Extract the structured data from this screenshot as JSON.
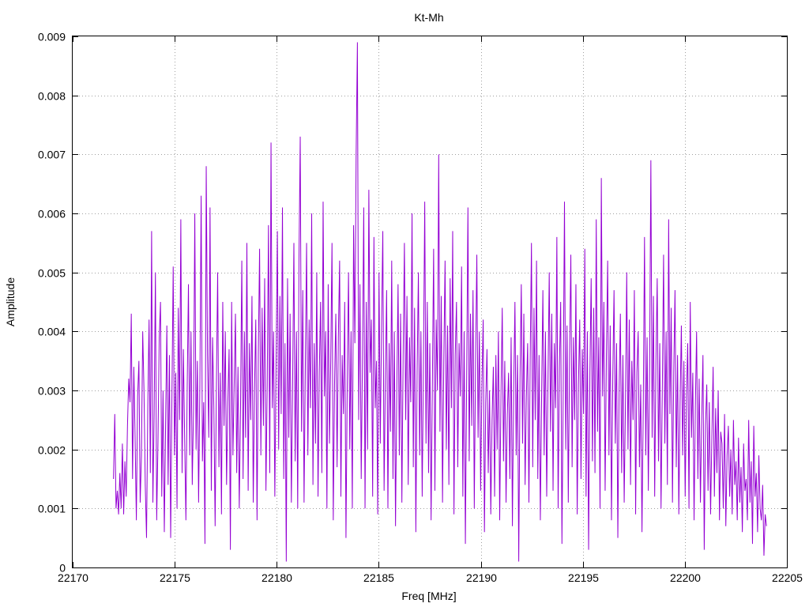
{
  "chart_data": {
    "type": "line",
    "title": "Kt-Mh",
    "xlabel": "Freq [MHz]",
    "ylabel": "Amplitude",
    "xlim": [
      22170,
      22205
    ],
    "ylim": [
      0,
      0.009
    ],
    "x_ticks": [
      "22170",
      "22175",
      "22180",
      "22185",
      "22190",
      "22195",
      "22200",
      "22205"
    ],
    "y_ticks": [
      "0",
      "0.001",
      "0.002",
      "0.003",
      "0.004",
      "0.005",
      "0.006",
      "0.007",
      "0.008",
      "0.009"
    ],
    "grid": true,
    "legend": "none",
    "series": [
      {
        "color": "#9400d3",
        "x_start": 22172.0,
        "x_end": 22204.0,
        "values": [
          0.0015,
          0.0026,
          0.001,
          0.0013,
          0.0009,
          0.0016,
          0.001,
          0.0021,
          0.0009,
          0.0018,
          0.0012,
          0.0024,
          0.0032,
          0.0028,
          0.0043,
          0.0015,
          0.0034,
          0.0022,
          0.0008,
          0.0029,
          0.0035,
          0.0011,
          0.0019,
          0.004,
          0.003,
          0.0014,
          0.0005,
          0.0027,
          0.0042,
          0.0016,
          0.0057,
          0.0011,
          0.0026,
          0.005,
          0.0008,
          0.0021,
          0.0039,
          0.0045,
          0.0012,
          0.003,
          0.0006,
          0.0024,
          0.0041,
          0.0014,
          0.0036,
          0.0005,
          0.0029,
          0.0051,
          0.0019,
          0.0033,
          0.001,
          0.0044,
          0.0025,
          0.0059,
          0.0016,
          0.0037,
          0.0022,
          0.0008,
          0.003,
          0.0048,
          0.0019,
          0.004,
          0.0014,
          0.0027,
          0.006,
          0.002,
          0.0035,
          0.0011,
          0.0031,
          0.0063,
          0.0018,
          0.0028,
          0.0004,
          0.0068,
          0.0036,
          0.0022,
          0.0061,
          0.0013,
          0.0039,
          0.0027,
          0.0007,
          0.0031,
          0.005,
          0.0017,
          0.0033,
          0.0009,
          0.0045,
          0.0024,
          0.004,
          0.0014,
          0.0028,
          0.0037,
          0.0003,
          0.0045,
          0.0019,
          0.0031,
          0.0043,
          0.0016,
          0.0034,
          0.001,
          0.0027,
          0.0052,
          0.0015,
          0.004,
          0.0022,
          0.0055,
          0.0013,
          0.0038,
          0.0025,
          0.0046,
          0.0011,
          0.003,
          0.0042,
          0.0008,
          0.0036,
          0.0054,
          0.0019,
          0.0044,
          0.0024,
          0.0049,
          0.0013,
          0.0031,
          0.0058,
          0.0016,
          0.0072,
          0.0027,
          0.004,
          0.0012,
          0.0035,
          0.0057,
          0.002,
          0.0046,
          0.0026,
          0.0061,
          0.0015,
          0.0038,
          0.0001,
          0.0049,
          0.0022,
          0.0043,
          0.0011,
          0.0031,
          0.0055,
          0.0018,
          0.004,
          0.001,
          0.0052,
          0.0073,
          0.0023,
          0.0047,
          0.0011,
          0.0034,
          0.0055,
          0.0019,
          0.0042,
          0.0027,
          0.006,
          0.0014,
          0.0038,
          0.0021,
          0.005,
          0.0012,
          0.0033,
          0.0045,
          0.0016,
          0.0062,
          0.0029,
          0.004,
          0.001,
          0.0048,
          0.0021,
          0.0035,
          0.0055,
          0.0008,
          0.0031,
          0.0043,
          0.0017,
          0.0039,
          0.0052,
          0.0012,
          0.0036,
          0.0026,
          0.0045,
          0.0005,
          0.0031,
          0.005,
          0.002,
          0.004,
          0.001,
          0.0058,
          0.0038,
          0.007,
          0.0089,
          0.0025,
          0.0048,
          0.0015,
          0.0036,
          0.0061,
          0.001,
          0.0045,
          0.002,
          0.0064,
          0.0033,
          0.0042,
          0.0012,
          0.0056,
          0.0027,
          0.0035,
          0.0009,
          0.005,
          0.0021,
          0.0041,
          0.0057,
          0.0013,
          0.0032,
          0.0047,
          0.001,
          0.0038,
          0.0023,
          0.0052,
          0.0015,
          0.004,
          0.0007,
          0.003,
          0.0048,
          0.0019,
          0.0043,
          0.0011,
          0.0036,
          0.0055,
          0.0025,
          0.0046,
          0.0014,
          0.0039,
          0.0028,
          0.006,
          0.0017,
          0.0044,
          0.0006,
          0.0033,
          0.005,
          0.0019,
          0.004,
          0.0012,
          0.0035,
          0.0062,
          0.0021,
          0.0045,
          0.0016,
          0.0038,
          0.0008,
          0.0031,
          0.0054,
          0.0013,
          0.0042,
          0.003,
          0.007,
          0.0023,
          0.0046,
          0.0011,
          0.0035,
          0.0052,
          0.002,
          0.0041,
          0.0014,
          0.0049,
          0.0027,
          0.0057,
          0.0009,
          0.0036,
          0.0045,
          0.0017,
          0.0038,
          0.0029,
          0.0051,
          0.0012,
          0.004,
          0.0004,
          0.0032,
          0.0061,
          0.0018,
          0.0043,
          0.0024,
          0.0047,
          0.001,
          0.0035,
          0.0053,
          0.0022,
          0.004,
          0.0013,
          0.0031,
          0.0042,
          0.0006,
          0.0028,
          0.0037,
          0.0016,
          0.003,
          0.0009,
          0.0025,
          0.0034,
          0.0012,
          0.0036,
          0.002,
          0.004,
          0.0008,
          0.0029,
          0.0044,
          0.0018,
          0.0035,
          0.0011,
          0.0026,
          0.0033,
          0.0015,
          0.0039,
          0.0007,
          0.003,
          0.0045,
          0.0019,
          0.0036,
          0.0001,
          0.0032,
          0.0048,
          0.0021,
          0.0043,
          0.0014,
          0.0029,
          0.0038,
          0.0011,
          0.0035,
          0.0055,
          0.0017,
          0.0044,
          0.0025,
          0.0052,
          0.0015,
          0.0036,
          0.0008,
          0.0029,
          0.0047,
          0.0019,
          0.004,
          0.0012,
          0.0031,
          0.005,
          0.0023,
          0.0043,
          0.0013,
          0.0038,
          0.0027,
          0.0056,
          0.001,
          0.0034,
          0.0045,
          0.0004,
          0.003,
          0.0062,
          0.002,
          0.0041,
          0.0011,
          0.0036,
          0.0053,
          0.0017,
          0.0039,
          0.0025,
          0.0048,
          0.0009,
          0.0031,
          0.0042,
          0.0015,
          0.0037,
          0.0026,
          0.0054,
          0.0012,
          0.004,
          0.0003,
          0.0033,
          0.0049,
          0.0018,
          0.0044,
          0.0016,
          0.0059,
          0.0023,
          0.0039,
          0.001,
          0.0066,
          0.0029,
          0.0045,
          0.0013,
          0.0036,
          0.0052,
          0.0019,
          0.0041,
          0.0008,
          0.0032,
          0.0047,
          0.0021,
          0.0038,
          0.0005,
          0.003,
          0.0043,
          0.0016,
          0.0036,
          0.0011,
          0.0028,
          0.005,
          0.002,
          0.0042,
          0.0014,
          0.0035,
          0.0025,
          0.0047,
          0.0009,
          0.0033,
          0.004,
          0.0017,
          0.0031,
          0.0006,
          0.0027,
          0.0056,
          0.0019,
          0.0039,
          0.0013,
          0.0034,
          0.0069,
          0.0022,
          0.0046,
          0.0012,
          0.0035,
          0.0049,
          0.0018,
          0.0038,
          0.001,
          0.003,
          0.0053,
          0.0021,
          0.004,
          0.0014,
          0.0059,
          0.0026,
          0.0044,
          0.0011,
          0.0033,
          0.0047,
          0.0017,
          0.0036,
          0.0009,
          0.0028,
          0.0041,
          0.0019,
          0.0035,
          0.0012,
          0.0029,
          0.0038,
          0.001,
          0.0045,
          0.0022,
          0.0033,
          0.0008,
          0.0027,
          0.004,
          0.0015,
          0.0032,
          0.0011,
          0.0025,
          0.0036,
          0.0003,
          0.0024,
          0.0031,
          0.0013,
          0.0028,
          0.0009,
          0.0022,
          0.0034,
          0.0012,
          0.0027,
          0.0016,
          0.003,
          0.0008,
          0.0023,
          0.0021,
          0.001,
          0.0026,
          0.0007,
          0.0019,
          0.0024,
          0.0012,
          0.002,
          0.0009,
          0.0025,
          0.0014,
          0.0018,
          0.0008,
          0.0022,
          0.0011,
          0.0017,
          0.0006,
          0.0021,
          0.0013,
          0.0015,
          0.0008,
          0.0025,
          0.0011,
          0.0018,
          0.0004,
          0.0024,
          0.0012,
          0.0016,
          0.0006,
          0.0019,
          0.001,
          0.0008,
          0.0014,
          0.0002,
          0.0009,
          0.0007
        ]
      }
    ]
  }
}
